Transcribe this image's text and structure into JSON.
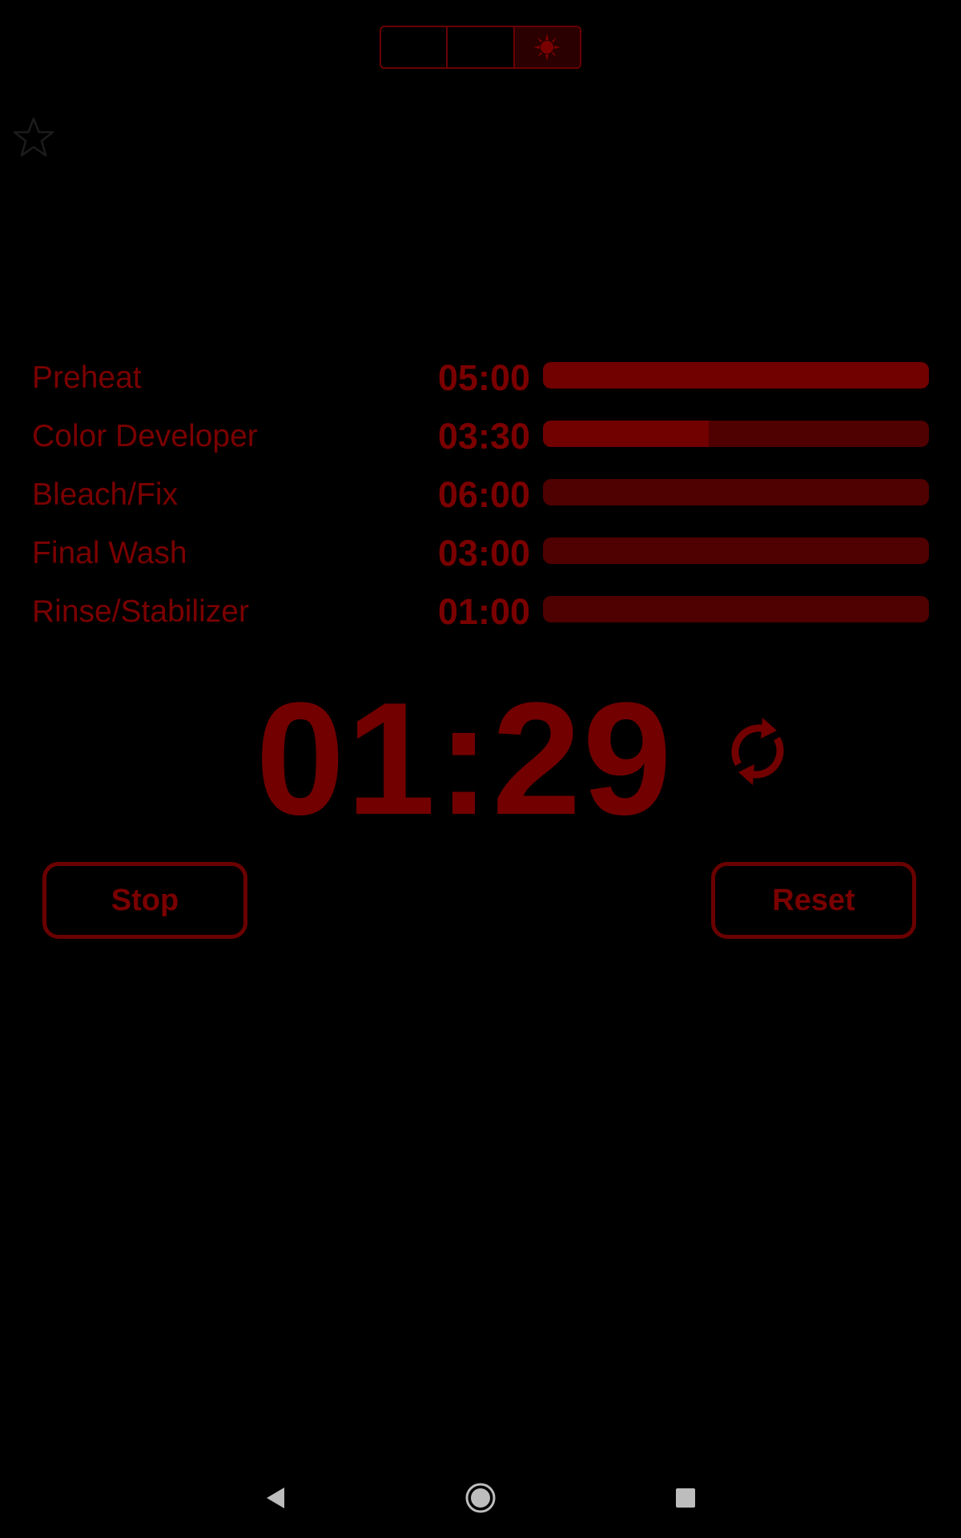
{
  "colors": {
    "background": "#000000",
    "accent": "#720000",
    "bar_track": "#4f0000",
    "bar_fill": "#710000",
    "border": "#6a0000"
  },
  "theme_switch": {
    "segments": [
      {
        "icon": "",
        "active": false
      },
      {
        "icon": "",
        "active": false
      },
      {
        "icon": "sun-icon",
        "active": true
      }
    ]
  },
  "favorite": {
    "icon": "star-outline-icon"
  },
  "steps": [
    {
      "name": "Preheat",
      "time": "05:00",
      "progress": 1.0
    },
    {
      "name": "Color Developer",
      "time": "03:30",
      "progress": 0.43
    },
    {
      "name": "Bleach/Fix",
      "time": "06:00",
      "progress": 0
    },
    {
      "name": "Final Wash",
      "time": "03:00",
      "progress": 0
    },
    {
      "name": "Rinse/Stabilizer",
      "time": "01:00",
      "progress": 0
    }
  ],
  "timer": {
    "value": "01:29",
    "icon": "refresh-icon"
  },
  "buttons": {
    "stop_label": "Stop",
    "reset_label": "Reset"
  },
  "navigation": {
    "back_icon": "back-icon",
    "home_icon": "home-icon",
    "recents_icon": "recents-icon"
  }
}
